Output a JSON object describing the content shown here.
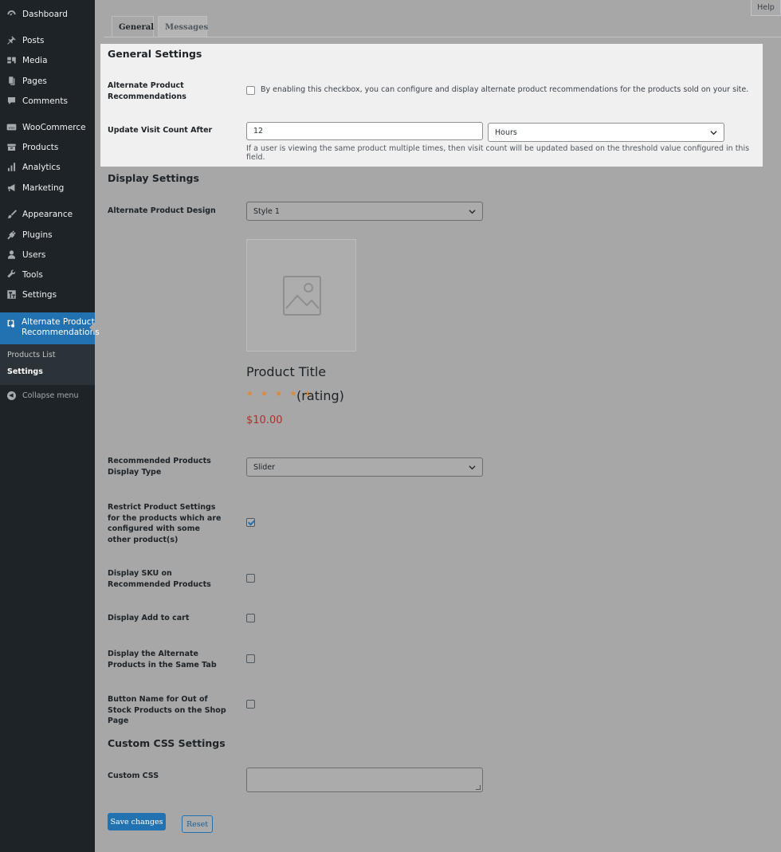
{
  "sidebar": {
    "items": [
      {
        "label": "Dashboard",
        "icon": "dashboard-icon"
      },
      {
        "label": "Posts",
        "icon": "pin-icon"
      },
      {
        "label": "Media",
        "icon": "media-icon"
      },
      {
        "label": "Pages",
        "icon": "pages-icon"
      },
      {
        "label": "Comments",
        "icon": "comment-icon"
      },
      {
        "label": "WooCommerce",
        "icon": "woocommerce-icon"
      },
      {
        "label": "Products",
        "icon": "archive-icon"
      },
      {
        "label": "Analytics",
        "icon": "bar-chart-icon"
      },
      {
        "label": "Marketing",
        "icon": "megaphone-icon"
      },
      {
        "label": "Appearance",
        "icon": "brush-icon"
      },
      {
        "label": "Plugins",
        "icon": "plug-icon"
      },
      {
        "label": "Users",
        "icon": "user-icon"
      },
      {
        "label": "Tools",
        "icon": "wrench-icon"
      },
      {
        "label": "Settings",
        "icon": "settings-icon"
      }
    ],
    "active": {
      "label_line1": "Alternate Product",
      "label_line2": "Recommendations",
      "icon": "recommendations-icon"
    },
    "submenu": [
      {
        "label": "Products List"
      },
      {
        "label": "Settings"
      }
    ],
    "collapse_label": "Collapse menu"
  },
  "header": {
    "help_label": "Help"
  },
  "tabs": [
    {
      "label": "General",
      "active": true
    },
    {
      "label": "Messages",
      "active": false
    }
  ],
  "general": {
    "title": "General Settings",
    "alt_recommendations": {
      "label": "Alternate Product Recommendations",
      "checked": false,
      "description": "By enabling this checkbox, you can configure and display alternate product recommendations for the products sold on your site."
    },
    "visit_count": {
      "label": "Update Visit Count After",
      "value": "12",
      "unit": "Hours",
      "description": "If a user is viewing the same product multiple times, then visit count will be updated based on the threshold value configured in this field."
    }
  },
  "display": {
    "title": "Display Settings",
    "design": {
      "label": "Alternate Product Design",
      "value": "Style 1"
    },
    "preview": {
      "title": "Product Title",
      "stars": "★ ★ ★ ★ ★",
      "rating": "(rating)",
      "price": "$10.00"
    },
    "display_type": {
      "label": "Recommended Products Display Type",
      "value": "Slider"
    },
    "restrict": {
      "label": "Restrict Product Settings for the products which are configured with some other product(s)",
      "checked": true
    },
    "sku": {
      "label": "Display SKU on Recommended Products",
      "checked": false
    },
    "add_to_cart": {
      "label": "Display Add to cart",
      "checked": false
    },
    "same_tab": {
      "label": "Display the Alternate Products in the Same Tab",
      "checked": false
    },
    "out_of_stock": {
      "label": "Button Name for Out of Stock Products on the Shop Page",
      "checked": false
    }
  },
  "css": {
    "title": "Custom CSS Settings",
    "label": "Custom CSS",
    "value": ""
  },
  "actions": {
    "save_label": "Save changes",
    "reset_label": "Reset"
  },
  "colors": {
    "accent": "#2271b1",
    "sidebar": "#1d2327",
    "star": "#dd8a38",
    "price": "#b32d2e"
  }
}
